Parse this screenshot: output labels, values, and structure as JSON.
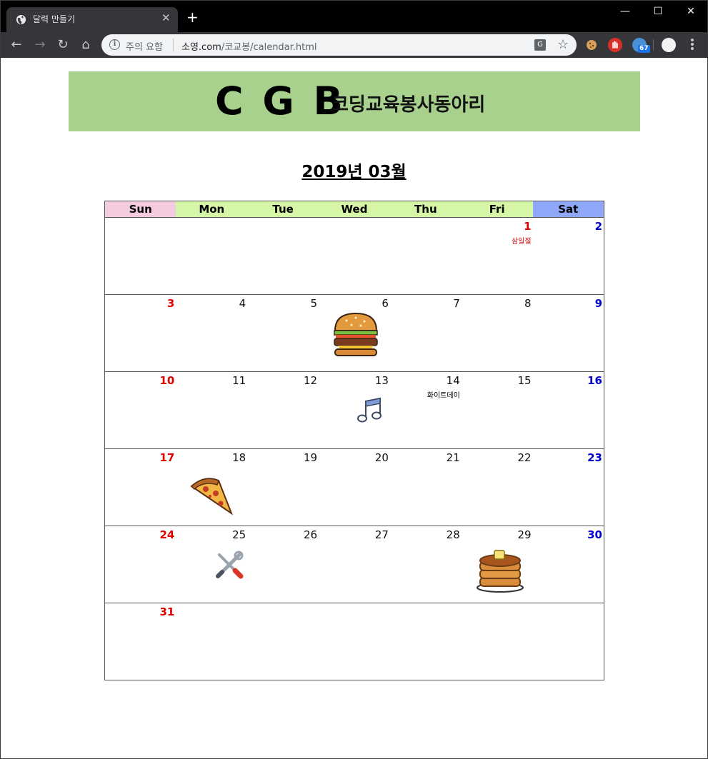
{
  "browser": {
    "tab_title": "달력 만들기",
    "security_warning": "주의 요함",
    "url_host": "소영.com",
    "url_path": "/코교봉/calendar.html",
    "extension_badge": "67"
  },
  "banner": {
    "logo_text": "C G B",
    "subtitle": "코딩교육봉사동아리",
    "background": "#a9d18e"
  },
  "calendar": {
    "title": "2019년 03월",
    "weekdays": [
      "Sun",
      "Mon",
      "Tue",
      "Wed",
      "Thu",
      "Fri",
      "Sat"
    ],
    "colors": {
      "sun_header": "#f5cbe0",
      "sat_header": "#8ea8f7",
      "weekday_header": "#d5f5a7",
      "holiday": "#e00000",
      "saturday": "#0000cc"
    },
    "weeks": [
      [
        {
          "day": ""
        },
        {
          "day": ""
        },
        {
          "day": ""
        },
        {
          "day": ""
        },
        {
          "day": ""
        },
        {
          "day": "1",
          "note": "삼일절",
          "holiday": true
        },
        {
          "day": "2"
        }
      ],
      [
        {
          "day": "3"
        },
        {
          "day": "4"
        },
        {
          "day": "5"
        },
        {
          "day": "6",
          "icon": "hamburger-icon"
        },
        {
          "day": "7"
        },
        {
          "day": "8"
        },
        {
          "day": "9"
        }
      ],
      [
        {
          "day": "10"
        },
        {
          "day": "11"
        },
        {
          "day": "12"
        },
        {
          "day": "13",
          "icon": "music-note-icon"
        },
        {
          "day": "14",
          "note": "화이트데이"
        },
        {
          "day": "15"
        },
        {
          "day": "16"
        }
      ],
      [
        {
          "day": "17"
        },
        {
          "day": "18",
          "icon": "pizza-slice-icon"
        },
        {
          "day": "19"
        },
        {
          "day": "20"
        },
        {
          "day": "21"
        },
        {
          "day": "22"
        },
        {
          "day": "23"
        }
      ],
      [
        {
          "day": "24"
        },
        {
          "day": "25",
          "icon": "wrench-screwdriver-icon"
        },
        {
          "day": "26"
        },
        {
          "day": "27"
        },
        {
          "day": "28"
        },
        {
          "day": "29",
          "icon": "pancakes-icon"
        },
        {
          "day": "30"
        }
      ],
      [
        {
          "day": "31"
        },
        {
          "day": ""
        },
        {
          "day": ""
        },
        {
          "day": ""
        },
        {
          "day": ""
        },
        {
          "day": ""
        },
        {
          "day": ""
        }
      ]
    ]
  }
}
